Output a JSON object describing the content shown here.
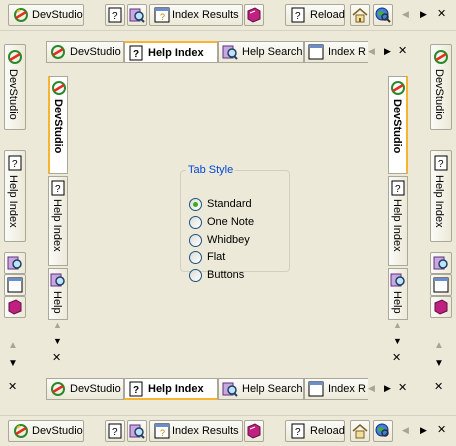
{
  "toolbar": {
    "devstudio": "DevStudio",
    "index_results": "Index Results",
    "reload": "Reload",
    "nav_prev": "◀",
    "nav_next": "▶",
    "close": "✕"
  },
  "side": {
    "devstudio": "DevStudio",
    "help_index": "Help Index",
    "up": "▲",
    "down": "▼",
    "close": "✕"
  },
  "tabs": {
    "devstudio": "DevStudio",
    "help_index": "Help Index",
    "help_search": "Help Search",
    "index_r": "Index R",
    "nav_prev": "◀",
    "nav_next": "▶",
    "close": "✕"
  },
  "vtabs": {
    "devstudio": "DevStudio",
    "help_index": "Help Index",
    "help": "Help",
    "up": "▲",
    "down": "▼",
    "close": "✕"
  },
  "tab_style": {
    "legend": "Tab Style",
    "options": [
      "Standard",
      "One Note",
      "Whidbey",
      "Flat",
      "Buttons"
    ],
    "selected": "Standard"
  },
  "colors": {
    "accent": "#f8b430",
    "background": "#ece9d8",
    "legend": "#0046d5",
    "radio_dot": "#3cac20"
  }
}
